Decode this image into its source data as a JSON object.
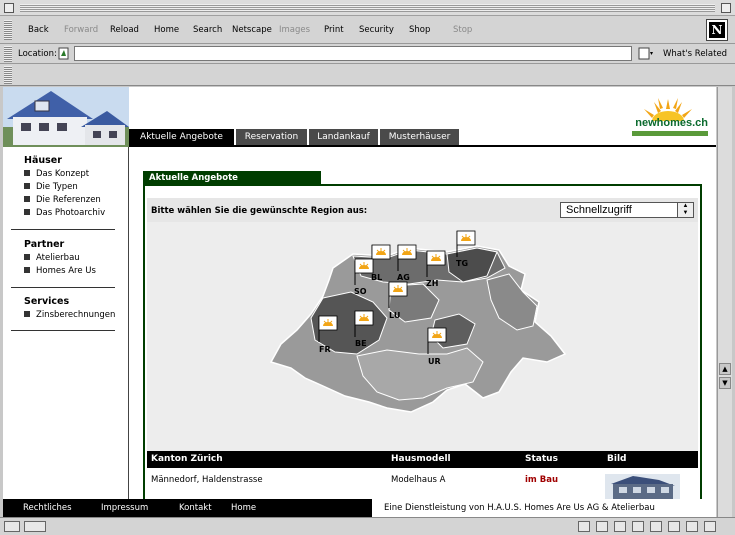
{
  "toolbar": {
    "back": "Back",
    "forward": "Forward",
    "reload": "Reload",
    "home": "Home",
    "search": "Search",
    "netscape": "Netscape",
    "images": "Images",
    "print": "Print",
    "security": "Security",
    "shop": "Shop",
    "stop": "Stop",
    "logo": "N"
  },
  "location": {
    "label": "Location:",
    "value": "",
    "related": "What's Related"
  },
  "site": {
    "logo": "newhomes.ch",
    "nav": [
      "Aktuelle Angebote",
      "Reservation",
      "Landankauf",
      "Musterhäuser"
    ],
    "sidebar": {
      "sections": [
        {
          "title": "Häuser",
          "items": [
            "Das Konzept",
            "Die Typen",
            "Die Referenzen",
            "Das Photoarchiv"
          ]
        },
        {
          "title": "Partner",
          "items": [
            "Atelierbau",
            "Homes Are Us"
          ]
        },
        {
          "title": "Services",
          "items": [
            "Zinsberechnungen"
          ]
        }
      ]
    },
    "panel_title": "Aktuelle Angebote",
    "region_prompt": "Bitte wählen Sie die gewünschte Region aus:",
    "quick_access": "Schnellzugriff",
    "cantons": [
      "BL",
      "AG",
      "ZH",
      "TG",
      "SO",
      "LU",
      "FR",
      "BE",
      "UR"
    ],
    "results": {
      "headers": {
        "canton": "Kanton Zürich",
        "model": "Hausmodell",
        "status": "Status",
        "image": "Bild"
      },
      "rows": [
        {
          "location": "Männedorf, Haldenstrasse",
          "model": "Modelhaus A",
          "status": "im Bau"
        }
      ]
    },
    "footer": {
      "links": [
        "Rechtliches",
        "Impressum",
        "Kontakt",
        "Home"
      ],
      "credit": "Eine Dienstleistung von H.A.U.S. Homes Are Us AG & Atelierbau"
    }
  },
  "colors": {
    "brand_green": "#003d00",
    "status_red": "#a00000"
  }
}
